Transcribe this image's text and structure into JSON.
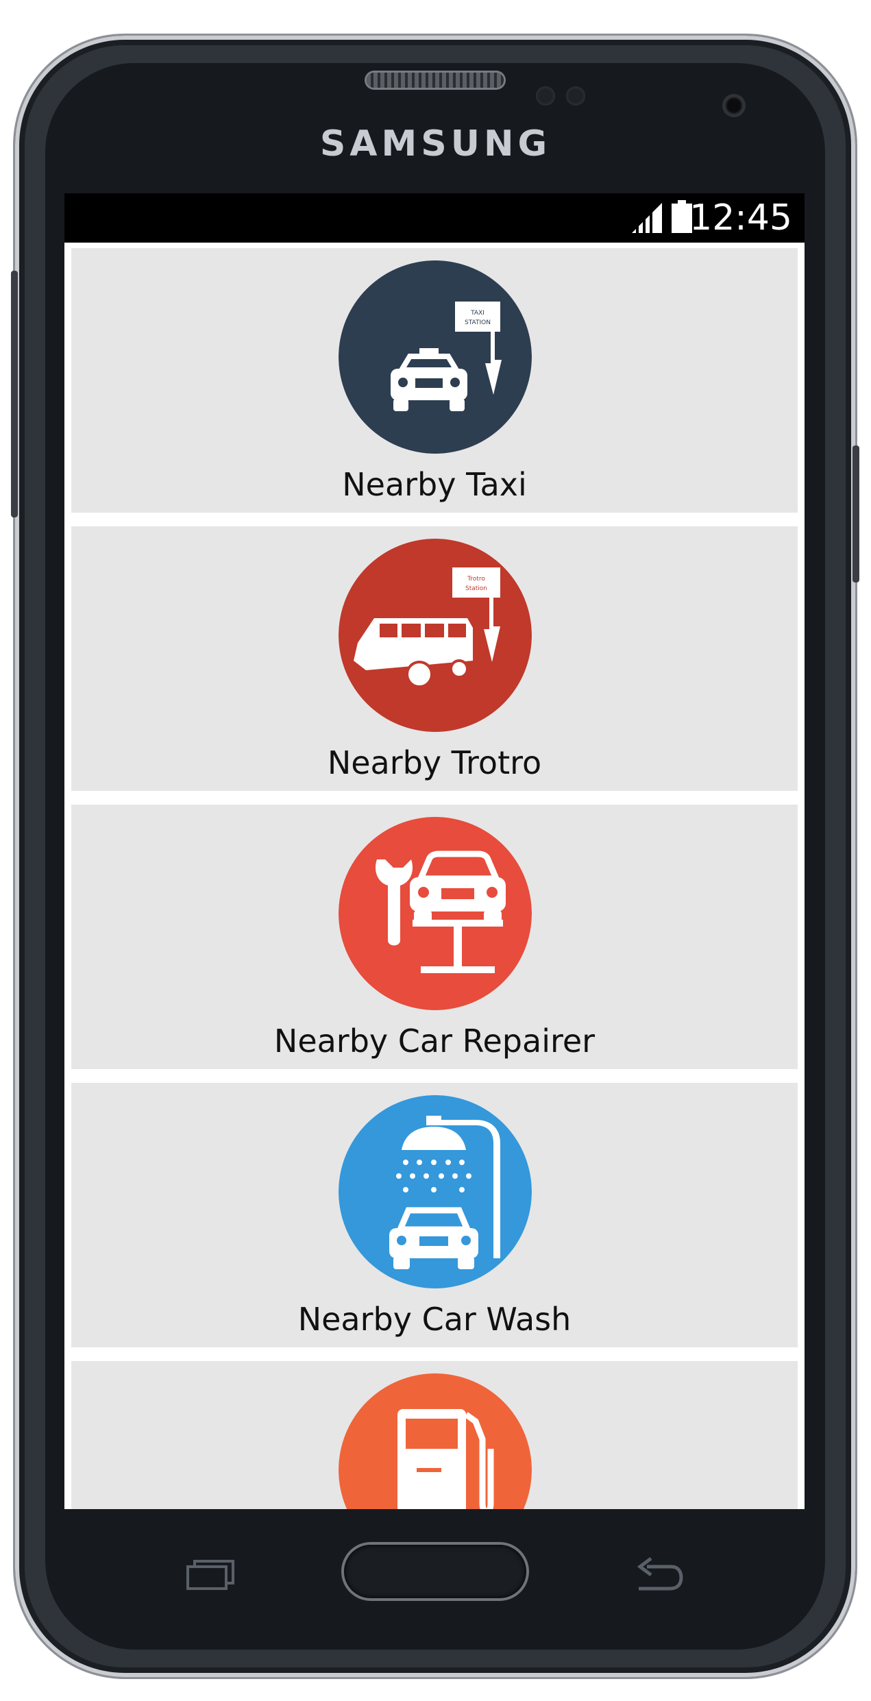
{
  "device": {
    "brand": "SAMSUNG"
  },
  "status_bar": {
    "time": "12:45"
  },
  "menu": [
    {
      "label": "Nearby Taxi",
      "icon": "taxi-station-icon",
      "color": "#2e3e51",
      "sign_text_1": "TAXI",
      "sign_text_2": "STATION"
    },
    {
      "label": "Nearby Trotro",
      "icon": "trotro-station-icon",
      "color": "#c0392b",
      "sign_text_1": "Trotro",
      "sign_text_2": "Station"
    },
    {
      "label": "Nearby Car Repairer",
      "icon": "car-repair-icon",
      "color": "#e74c3c"
    },
    {
      "label": "Nearby Car Wash",
      "icon": "car-wash-icon",
      "color": "#3498db"
    },
    {
      "label": "",
      "icon": "fuel-station-icon",
      "color": "#f0643a"
    }
  ],
  "nav_buttons": {
    "recent": "recent-apps-icon",
    "home": "home-button",
    "back": "back-icon"
  }
}
